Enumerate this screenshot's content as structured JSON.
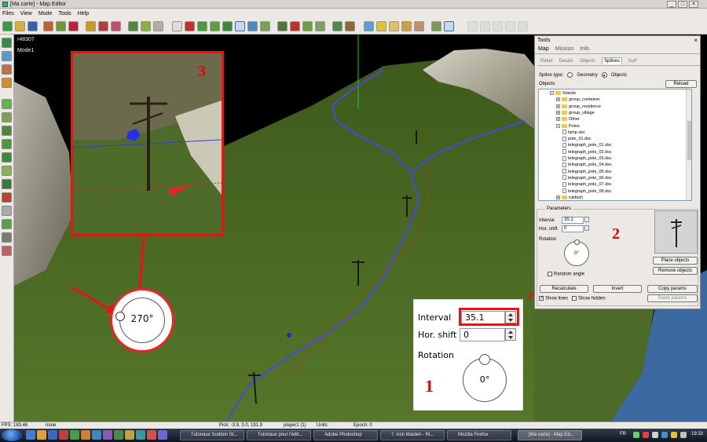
{
  "window": {
    "title": "[Ma carte] - Map Editor"
  },
  "menu": [
    "Files",
    "View",
    "Mode",
    "Tools",
    "Help"
  ],
  "viewport": {
    "info_r": "r48307",
    "info_mode": "Mode1"
  },
  "annotations": {
    "n1": "1",
    "n2": "2",
    "n3": "3",
    "circle_value": "270°"
  },
  "tools": {
    "title": "Tools",
    "close": "×",
    "tabs": [
      "Map",
      "Mission",
      "Info"
    ],
    "subtabs": [
      "Relief",
      "Decals",
      "Objects",
      "Splines",
      "Surf"
    ],
    "spline_type_label": "Spline type:",
    "geometry_label": "Geometry",
    "objects_option_label": "Objects",
    "objects_label": "Objects",
    "reload_label": "Reload",
    "tree": [
      {
        "label": "Stands",
        "kind": "folder-open",
        "box": "−"
      },
      {
        "label": "group_container",
        "kind": "folder",
        "box": "+"
      },
      {
        "label": "group_residence",
        "kind": "folder",
        "box": "+"
      },
      {
        "label": "group_village",
        "kind": "folder",
        "box": "+"
      },
      {
        "label": "Other",
        "kind": "folder",
        "box": "+"
      },
      {
        "label": "Poles",
        "kind": "folder-open",
        "box": "−"
      },
      {
        "label": "lamp.dsc",
        "kind": "file",
        "box": ""
      },
      {
        "label": "pole_01.dsc",
        "kind": "file",
        "box": ""
      },
      {
        "label": "telegraph_pole_01.dsc",
        "kind": "file",
        "box": ""
      },
      {
        "label": "telegraph_pole_02.dsc",
        "kind": "file",
        "box": ""
      },
      {
        "label": "telegraph_pole_03.dsc",
        "kind": "file",
        "box": ""
      },
      {
        "label": "telegraph_pole_04.dsc",
        "kind": "file",
        "box": ""
      },
      {
        "label": "telegraph_pole_05.dsc",
        "kind": "file",
        "box": ""
      },
      {
        "label": "telegraph_pole_06.dsc",
        "kind": "file",
        "box": ""
      },
      {
        "label": "telegraph_pole_07.dsc",
        "kind": "file",
        "box": ""
      },
      {
        "label": "telegraph_pole_08.dsc",
        "kind": "file",
        "box": ""
      },
      {
        "label": "rubbish",
        "kind": "folder",
        "box": "+"
      }
    ],
    "parameters_label": "Parameters",
    "interval_label": "Interval",
    "interval_value": "35.1",
    "hshift_label": "Hor. shift",
    "hshift_value": "0",
    "rotation_label": "Rotation",
    "rotation_value": "0°",
    "random_angle_label": "Random angle",
    "place_objects": "Place objects",
    "remove_objects": "Remove objects",
    "recalculate": "Recalculate",
    "invert": "Invert",
    "copy_params": "Copy params",
    "paste_params": "Paste params",
    "show_lines": "Show lines",
    "show_hidden": "Show hidden"
  },
  "zoom": {
    "interval_label": "Interval",
    "interval_value": "35.1",
    "hshift_label": "Hor. shift",
    "hshift_value": "0",
    "rotation_label": "Rotation",
    "rotation_value": "0°"
  },
  "status": {
    "fps": "FPS: 183.46",
    "selection": "none",
    "pick": "Pick: -3.9, 3.0, 191.9",
    "player": "player1 (1)",
    "units": "Units:",
    "epoch": "Epoch: 0"
  },
  "taskbar": {
    "tasks": [
      "Tutoriaux Sudden St...",
      "Tutoriaux pour l'édit...",
      "Adobe Photoshop",
      "7. Iron Maiden - Ri...",
      "Mozilla Firefox",
      "[Ma carte] - Map Ed..."
    ],
    "lang": "FR",
    "clock": "19:33"
  },
  "colors": {
    "annotation_red": "#e11111",
    "spline_blue": "#3a3ad8",
    "grass": "#4e6e22",
    "sky": "#000000"
  }
}
